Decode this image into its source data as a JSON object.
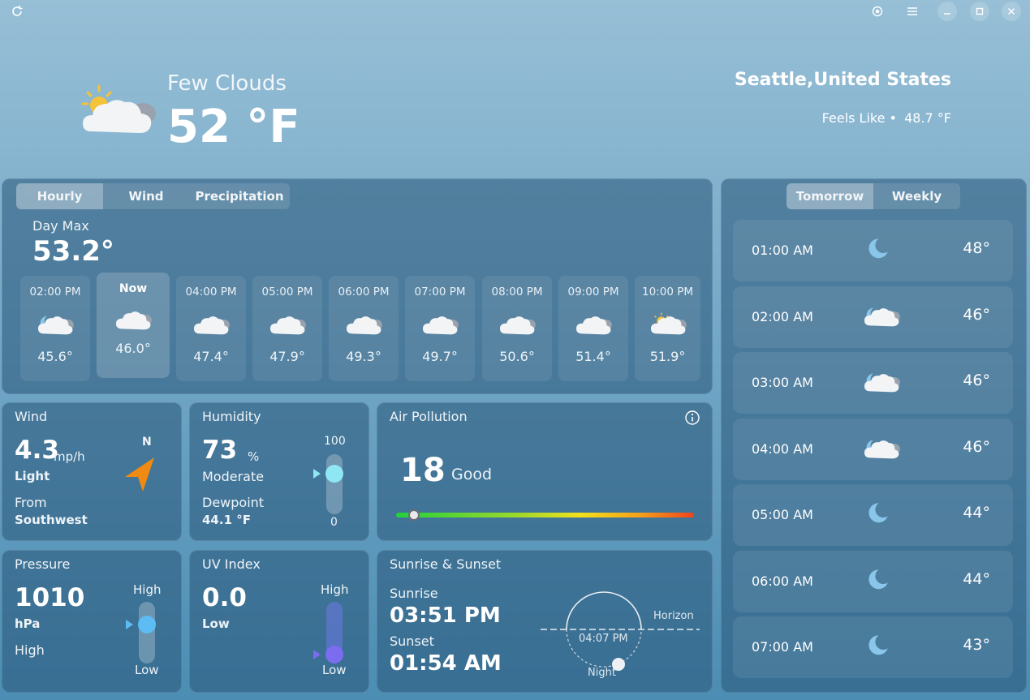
{
  "titlebar": {
    "refresh_icon": "refresh-icon",
    "location_icon": "location-icon",
    "menu_icon": "menu-icon"
  },
  "current": {
    "condition": "Few Clouds",
    "temperature": "52 °F",
    "location": "Seattle,United States",
    "feels_like_label": "Feels Like •",
    "feels_like_value": "48.7 °F"
  },
  "hourly_panel": {
    "tabs": [
      "Hourly",
      "Wind",
      "Precipitation"
    ],
    "day_max_label": "Day Max",
    "day_max_value": "53.2°",
    "hours": [
      {
        "time": "02:00 PM",
        "icon": "night-cloud-icon",
        "temp": "45.6°"
      },
      {
        "time": "Now",
        "icon": "cloud-icon",
        "temp": "46.0°"
      },
      {
        "time": "04:00 PM",
        "icon": "cloud-icon",
        "temp": "47.4°"
      },
      {
        "time": "05:00 PM",
        "icon": "cloud-icon",
        "temp": "47.9°"
      },
      {
        "time": "06:00 PM",
        "icon": "cloud-icon",
        "temp": "49.3°"
      },
      {
        "time": "07:00 PM",
        "icon": "cloud-icon",
        "temp": "49.7°"
      },
      {
        "time": "08:00 PM",
        "icon": "cloud-icon",
        "temp": "50.6°"
      },
      {
        "time": "09:00 PM",
        "icon": "cloud-icon",
        "temp": "51.4°"
      },
      {
        "time": "10:00 PM",
        "icon": "sun-cloud-icon",
        "temp": "51.9°"
      }
    ]
  },
  "wind": {
    "title": "Wind",
    "speed": "4.3",
    "unit": "mp/h",
    "desc": "Light",
    "from_label": "From",
    "from_value": "Southwest",
    "compass": "N"
  },
  "humidity": {
    "title": "Humidity",
    "value": "73",
    "unit": "%",
    "desc": "Moderate",
    "dew_label": "Dewpoint",
    "dew_value": "44.1 °F",
    "max": "100",
    "min": "0",
    "level": 0.73
  },
  "air": {
    "title": "Air Pollution",
    "value": "18",
    "desc": "Good",
    "level": 0.06
  },
  "pressure": {
    "title": "Pressure",
    "value": "1010",
    "unit": "hPa",
    "desc": "High",
    "high": "High",
    "low": "Low",
    "level": 0.62
  },
  "uv": {
    "title": "UV Index",
    "value": "0.0",
    "desc": "Low",
    "high": "High",
    "low": "Low",
    "level": 0.0
  },
  "sun": {
    "title": "Sunrise & Sunset",
    "sunrise_label": "Sunrise",
    "sunrise": "03:51 PM",
    "sunset_label": "Sunset",
    "sunset": "01:54 AM",
    "horizon": "Horizon",
    "time": "04:07 PM",
    "night": "Night"
  },
  "forecast": {
    "tabs": [
      "Tomorrow",
      "Weekly"
    ],
    "rows": [
      {
        "time": "01:00 AM",
        "icon": "moon-icon",
        "temp": "48°"
      },
      {
        "time": "02:00 AM",
        "icon": "night-cloud-icon",
        "temp": "46°"
      },
      {
        "time": "03:00 AM",
        "icon": "night-cloud-icon",
        "temp": "46°"
      },
      {
        "time": "04:00 AM",
        "icon": "night-cloud-icon",
        "temp": "46°"
      },
      {
        "time": "05:00 AM",
        "icon": "moon-icon",
        "temp": "44°"
      },
      {
        "time": "06:00 AM",
        "icon": "moon-icon",
        "temp": "44°"
      },
      {
        "time": "07:00 AM",
        "icon": "moon-icon",
        "temp": "43°"
      }
    ]
  }
}
